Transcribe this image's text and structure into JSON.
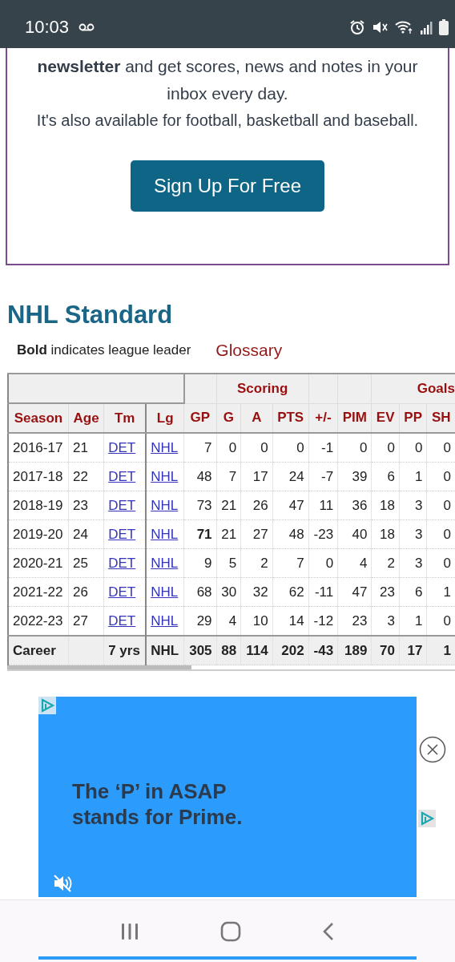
{
  "status_bar": {
    "time": "10:03"
  },
  "newsletter": {
    "text": "**newsletter** and get scores, news and notes in your inbox every day.",
    "note": "It's also available for football, basketball and baseball.",
    "button": "Sign Up For Free"
  },
  "section": {
    "title": "NHL Standard",
    "legend": "**Bold** indicates league leader",
    "glossary": "Glossary"
  },
  "table": {
    "groups": [
      {
        "kind": "blank",
        "columns": [
          {
            "label": "Season",
            "kind": "text"
          },
          {
            "label": "Age",
            "kind": "text"
          },
          {
            "label": "Tm",
            "kind": "link"
          },
          {
            "label": "Lg",
            "kind": "link"
          }
        ]
      },
      {
        "kind": "plain",
        "columns": [
          {
            "label": "GP",
            "kind": "num"
          }
        ]
      },
      {
        "kind": "plain",
        "label": "Scoring",
        "columns": [
          {
            "label": "G",
            "kind": "num"
          },
          {
            "label": "A",
            "kind": "num"
          },
          {
            "label": "PTS",
            "kind": "num"
          }
        ]
      },
      {
        "kind": "plain",
        "columns": [
          {
            "label": "+/-",
            "kind": "num"
          }
        ]
      },
      {
        "kind": "plain",
        "columns": [
          {
            "label": "PIM",
            "kind": "num"
          }
        ]
      },
      {
        "kind": "right",
        "label": "Goals",
        "columns": [
          {
            "label": "EV",
            "kind": "num"
          },
          {
            "label": "PP",
            "kind": "num"
          },
          {
            "label": "SH",
            "kind": "num"
          }
        ]
      }
    ],
    "rows": [
      {
        "kind": "season",
        "cells": [
          {
            "text": "2016-17",
            "leader": false
          },
          {
            "text": "21",
            "leader": false
          },
          {
            "text": "DET",
            "leader": false
          },
          {
            "text": "NHL",
            "leader": false
          },
          {
            "text": "7",
            "leader": false
          },
          {
            "text": "0",
            "leader": false
          },
          {
            "text": "0",
            "leader": false
          },
          {
            "text": "0",
            "leader": false
          },
          {
            "text": "-1",
            "leader": false
          },
          {
            "text": "0",
            "leader": false
          },
          {
            "text": "0",
            "leader": false
          },
          {
            "text": "0",
            "leader": false
          },
          {
            "text": "0",
            "leader": false
          }
        ]
      },
      {
        "kind": "season",
        "cells": [
          {
            "text": "2017-18",
            "leader": false
          },
          {
            "text": "22",
            "leader": false
          },
          {
            "text": "DET",
            "leader": false
          },
          {
            "text": "NHL",
            "leader": false
          },
          {
            "text": "48",
            "leader": false
          },
          {
            "text": "7",
            "leader": false
          },
          {
            "text": "17",
            "leader": false
          },
          {
            "text": "24",
            "leader": false
          },
          {
            "text": "-7",
            "leader": false
          },
          {
            "text": "39",
            "leader": false
          },
          {
            "text": "6",
            "leader": false
          },
          {
            "text": "1",
            "leader": false
          },
          {
            "text": "0",
            "leader": false
          }
        ]
      },
      {
        "kind": "season",
        "cells": [
          {
            "text": "2018-19",
            "leader": false
          },
          {
            "text": "23",
            "leader": false
          },
          {
            "text": "DET",
            "leader": false
          },
          {
            "text": "NHL",
            "leader": false
          },
          {
            "text": "73",
            "leader": false
          },
          {
            "text": "21",
            "leader": false
          },
          {
            "text": "26",
            "leader": false
          },
          {
            "text": "47",
            "leader": false
          },
          {
            "text": "11",
            "leader": false
          },
          {
            "text": "36",
            "leader": false
          },
          {
            "text": "18",
            "leader": false
          },
          {
            "text": "3",
            "leader": false
          },
          {
            "text": "0",
            "leader": false
          }
        ]
      },
      {
        "kind": "season",
        "cells": [
          {
            "text": "2019-20",
            "leader": false
          },
          {
            "text": "24",
            "leader": false
          },
          {
            "text": "DET",
            "leader": false
          },
          {
            "text": "NHL",
            "leader": false
          },
          {
            "text": "71",
            "leader": true
          },
          {
            "text": "21",
            "leader": false
          },
          {
            "text": "27",
            "leader": false
          },
          {
            "text": "48",
            "leader": false
          },
          {
            "text": "-23",
            "leader": false
          },
          {
            "text": "40",
            "leader": false
          },
          {
            "text": "18",
            "leader": false
          },
          {
            "text": "3",
            "leader": false
          },
          {
            "text": "0",
            "leader": false
          }
        ]
      },
      {
        "kind": "season",
        "cells": [
          {
            "text": "2020-21",
            "leader": false
          },
          {
            "text": "25",
            "leader": false
          },
          {
            "text": "DET",
            "leader": false
          },
          {
            "text": "NHL",
            "leader": false
          },
          {
            "text": "9",
            "leader": false
          },
          {
            "text": "5",
            "leader": false
          },
          {
            "text": "2",
            "leader": false
          },
          {
            "text": "7",
            "leader": false
          },
          {
            "text": "0",
            "leader": false
          },
          {
            "text": "4",
            "leader": false
          },
          {
            "text": "2",
            "leader": false
          },
          {
            "text": "3",
            "leader": false
          },
          {
            "text": "0",
            "leader": false
          }
        ]
      },
      {
        "kind": "season",
        "cells": [
          {
            "text": "2021-22",
            "leader": false
          },
          {
            "text": "26",
            "leader": false
          },
          {
            "text": "DET",
            "leader": false
          },
          {
            "text": "NHL",
            "leader": false
          },
          {
            "text": "68",
            "leader": false
          },
          {
            "text": "30",
            "leader": false
          },
          {
            "text": "32",
            "leader": false
          },
          {
            "text": "62",
            "leader": false
          },
          {
            "text": "-11",
            "leader": false
          },
          {
            "text": "47",
            "leader": false
          },
          {
            "text": "23",
            "leader": false
          },
          {
            "text": "6",
            "leader": false
          },
          {
            "text": "1",
            "leader": false
          }
        ]
      },
      {
        "kind": "season",
        "cells": [
          {
            "text": "2022-23",
            "leader": false
          },
          {
            "text": "27",
            "leader": false
          },
          {
            "text": "DET",
            "leader": false
          },
          {
            "text": "NHL",
            "leader": false
          },
          {
            "text": "29",
            "leader": false
          },
          {
            "text": "4",
            "leader": false
          },
          {
            "text": "10",
            "leader": false
          },
          {
            "text": "14",
            "leader": false
          },
          {
            "text": "-12",
            "leader": false
          },
          {
            "text": "23",
            "leader": false
          },
          {
            "text": "3",
            "leader": false
          },
          {
            "text": "1",
            "leader": false
          },
          {
            "text": "0",
            "leader": false
          }
        ]
      },
      {
        "kind": "total",
        "cells": [
          {
            "text": "Career"
          },
          {},
          {
            "text": "7 yrs"
          },
          {
            "text": "NHL"
          },
          {
            "text": "305"
          },
          {
            "text": "88"
          },
          {
            "text": "114"
          },
          {
            "text": "202"
          },
          {
            "text": "-43"
          },
          {
            "text": "189"
          },
          {
            "text": "70"
          },
          {
            "text": "17"
          },
          {
            "text": "1"
          }
        ]
      }
    ]
  },
  "ad": {
    "headline": "The ‘P’ in ASAP stands for Prime."
  }
}
